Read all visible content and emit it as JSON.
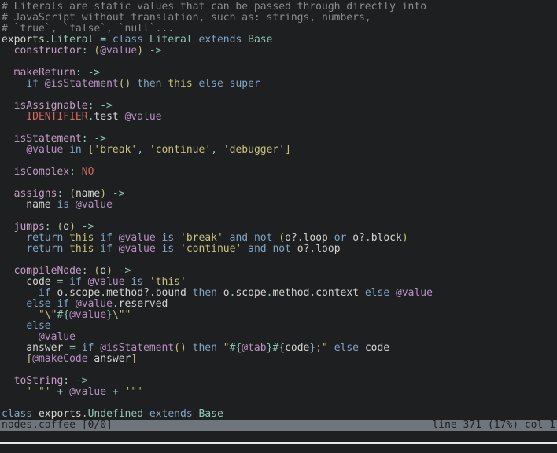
{
  "editor": {
    "filename": "nodes.coffee",
    "colors": {
      "background": "#1e1f21",
      "comment": "#8a8d91",
      "plain": "#d3d3d0",
      "class_name": "#8fc6b8",
      "keyword": "#7fa6c6",
      "property": "#c49dc5",
      "instance_var": "#b791c0",
      "string": "#c8c07a",
      "constant": "#d06a62",
      "statusbar_bg": "#6f767b"
    },
    "lines": [
      [
        [
          "comment",
          "# Literals are static values that can be passed through directly into"
        ]
      ],
      [
        [
          "comment",
          "# JavaScript without translation, such as: strings, numbers,"
        ]
      ],
      [
        [
          "comment",
          "# `true`, `false`, `null`..."
        ]
      ],
      [
        [
          "plain",
          "exports"
        ],
        [
          "op",
          "."
        ],
        [
          "class",
          "Literal"
        ],
        [
          "plain",
          " "
        ],
        [
          "op",
          "="
        ],
        [
          "plain",
          " "
        ],
        [
          "kw",
          "class"
        ],
        [
          "plain",
          " "
        ],
        [
          "class",
          "Literal"
        ],
        [
          "plain",
          " "
        ],
        [
          "kw",
          "extends"
        ],
        [
          "plain",
          " "
        ],
        [
          "class",
          "Base"
        ]
      ],
      [
        [
          "plain",
          "  "
        ],
        [
          "prop",
          "constructor"
        ],
        [
          "op",
          ":"
        ],
        [
          "plain",
          " "
        ],
        [
          "paren",
          "("
        ],
        [
          "ivar",
          "@value"
        ],
        [
          "paren",
          ")"
        ],
        [
          "plain",
          " "
        ],
        [
          "op",
          "->"
        ]
      ],
      [],
      [
        [
          "plain",
          "  "
        ],
        [
          "prop",
          "makeReturn"
        ],
        [
          "op",
          ":"
        ],
        [
          "plain",
          " "
        ],
        [
          "op",
          "->"
        ]
      ],
      [
        [
          "plain",
          "    "
        ],
        [
          "kw",
          "if"
        ],
        [
          "plain",
          " "
        ],
        [
          "ivar",
          "@isStatement"
        ],
        [
          "paren",
          "()"
        ],
        [
          "plain",
          " "
        ],
        [
          "kw",
          "then"
        ],
        [
          "plain",
          " "
        ],
        [
          "this",
          "this"
        ],
        [
          "plain",
          " "
        ],
        [
          "kw",
          "else"
        ],
        [
          "plain",
          " "
        ],
        [
          "kw",
          "super"
        ]
      ],
      [],
      [
        [
          "plain",
          "  "
        ],
        [
          "prop",
          "isAssignable"
        ],
        [
          "op",
          ":"
        ],
        [
          "plain",
          " "
        ],
        [
          "op",
          "->"
        ]
      ],
      [
        [
          "plain",
          "    "
        ],
        [
          "const",
          "IDENTIFIER"
        ],
        [
          "op",
          "."
        ],
        [
          "plain",
          "test "
        ],
        [
          "ivar",
          "@value"
        ]
      ],
      [],
      [
        [
          "plain",
          "  "
        ],
        [
          "prop",
          "isStatement"
        ],
        [
          "op",
          ":"
        ],
        [
          "plain",
          " "
        ],
        [
          "op",
          "->"
        ]
      ],
      [
        [
          "plain",
          "    "
        ],
        [
          "ivar",
          "@value"
        ],
        [
          "plain",
          " "
        ],
        [
          "kw",
          "in"
        ],
        [
          "plain",
          " "
        ],
        [
          "paren",
          "["
        ],
        [
          "str",
          "'break'"
        ],
        [
          "op",
          ","
        ],
        [
          "plain",
          " "
        ],
        [
          "str",
          "'continue'"
        ],
        [
          "op",
          ","
        ],
        [
          "plain",
          " "
        ],
        [
          "str",
          "'debugger'"
        ],
        [
          "paren",
          "]"
        ]
      ],
      [],
      [
        [
          "plain",
          "  "
        ],
        [
          "prop",
          "isComplex"
        ],
        [
          "op",
          ":"
        ],
        [
          "plain",
          " "
        ],
        [
          "const",
          "NO"
        ]
      ],
      [],
      [
        [
          "plain",
          "  "
        ],
        [
          "prop",
          "assigns"
        ],
        [
          "op",
          ":"
        ],
        [
          "plain",
          " "
        ],
        [
          "paren",
          "("
        ],
        [
          "plain",
          "name"
        ],
        [
          "paren",
          ")"
        ],
        [
          "plain",
          " "
        ],
        [
          "op",
          "->"
        ]
      ],
      [
        [
          "plain",
          "    name "
        ],
        [
          "kw",
          "is"
        ],
        [
          "plain",
          " "
        ],
        [
          "ivar",
          "@value"
        ]
      ],
      [],
      [
        [
          "plain",
          "  "
        ],
        [
          "prop",
          "jumps"
        ],
        [
          "op",
          ":"
        ],
        [
          "plain",
          " "
        ],
        [
          "paren",
          "("
        ],
        [
          "plain",
          "o"
        ],
        [
          "paren",
          ")"
        ],
        [
          "plain",
          " "
        ],
        [
          "op",
          "->"
        ]
      ],
      [
        [
          "plain",
          "    "
        ],
        [
          "kw",
          "return"
        ],
        [
          "plain",
          " "
        ],
        [
          "this",
          "this"
        ],
        [
          "plain",
          " "
        ],
        [
          "kw",
          "if"
        ],
        [
          "plain",
          " "
        ],
        [
          "ivar",
          "@value"
        ],
        [
          "plain",
          " "
        ],
        [
          "kw",
          "is"
        ],
        [
          "plain",
          " "
        ],
        [
          "str",
          "'break'"
        ],
        [
          "plain",
          " "
        ],
        [
          "kw",
          "and"
        ],
        [
          "plain",
          " "
        ],
        [
          "kw",
          "not"
        ],
        [
          "plain",
          " "
        ],
        [
          "paren",
          "("
        ],
        [
          "plain",
          "o?"
        ],
        [
          "op",
          "."
        ],
        [
          "plain",
          "loop "
        ],
        [
          "kw",
          "or"
        ],
        [
          "plain",
          " o?"
        ],
        [
          "op",
          "."
        ],
        [
          "plain",
          "block"
        ],
        [
          "paren",
          ")"
        ]
      ],
      [
        [
          "plain",
          "    "
        ],
        [
          "kw",
          "return"
        ],
        [
          "plain",
          " "
        ],
        [
          "this",
          "this"
        ],
        [
          "plain",
          " "
        ],
        [
          "kw",
          "if"
        ],
        [
          "plain",
          " "
        ],
        [
          "ivar",
          "@value"
        ],
        [
          "plain",
          " "
        ],
        [
          "kw",
          "is"
        ],
        [
          "plain",
          " "
        ],
        [
          "str",
          "'continue'"
        ],
        [
          "plain",
          " "
        ],
        [
          "kw",
          "and"
        ],
        [
          "plain",
          " "
        ],
        [
          "kw",
          "not"
        ],
        [
          "plain",
          " o?"
        ],
        [
          "op",
          "."
        ],
        [
          "plain",
          "loop"
        ]
      ],
      [],
      [
        [
          "plain",
          "  "
        ],
        [
          "prop",
          "compileNode"
        ],
        [
          "op",
          ":"
        ],
        [
          "plain",
          " "
        ],
        [
          "paren",
          "("
        ],
        [
          "plain",
          "o"
        ],
        [
          "paren",
          ")"
        ],
        [
          "plain",
          " "
        ],
        [
          "op",
          "->"
        ]
      ],
      [
        [
          "plain",
          "    code "
        ],
        [
          "op",
          "="
        ],
        [
          "plain",
          " "
        ],
        [
          "kw",
          "if"
        ],
        [
          "plain",
          " "
        ],
        [
          "ivar",
          "@value"
        ],
        [
          "plain",
          " "
        ],
        [
          "kw",
          "is"
        ],
        [
          "plain",
          " "
        ],
        [
          "str",
          "'this'"
        ]
      ],
      [
        [
          "plain",
          "      "
        ],
        [
          "kw",
          "if"
        ],
        [
          "plain",
          " o"
        ],
        [
          "op",
          "."
        ],
        [
          "plain",
          "scope"
        ],
        [
          "op",
          "."
        ],
        [
          "plain",
          "method?"
        ],
        [
          "op",
          "."
        ],
        [
          "plain",
          "bound "
        ],
        [
          "kw",
          "then"
        ],
        [
          "plain",
          " o"
        ],
        [
          "op",
          "."
        ],
        [
          "plain",
          "scope"
        ],
        [
          "op",
          "."
        ],
        [
          "plain",
          "method"
        ],
        [
          "op",
          "."
        ],
        [
          "plain",
          "context "
        ],
        [
          "kw",
          "else"
        ],
        [
          "plain",
          " "
        ],
        [
          "ivar",
          "@value"
        ]
      ],
      [
        [
          "plain",
          "    "
        ],
        [
          "kw",
          "else"
        ],
        [
          "plain",
          " "
        ],
        [
          "kw",
          "if"
        ],
        [
          "plain",
          " "
        ],
        [
          "ivar",
          "@value"
        ],
        [
          "op",
          "."
        ],
        [
          "plain",
          "reserved"
        ]
      ],
      [
        [
          "plain",
          "      "
        ],
        [
          "str",
          "\"\\\""
        ],
        [
          "interp",
          "#{"
        ],
        [
          "ivar",
          "@value"
        ],
        [
          "interp",
          "}"
        ],
        [
          "str",
          "\\\"\""
        ]
      ],
      [
        [
          "plain",
          "    "
        ],
        [
          "kw",
          "else"
        ]
      ],
      [
        [
          "plain",
          "      "
        ],
        [
          "ivar",
          "@value"
        ]
      ],
      [
        [
          "plain",
          "    answer "
        ],
        [
          "op",
          "="
        ],
        [
          "plain",
          " "
        ],
        [
          "kw",
          "if"
        ],
        [
          "plain",
          " "
        ],
        [
          "ivar",
          "@isStatement"
        ],
        [
          "paren",
          "()"
        ],
        [
          "plain",
          " "
        ],
        [
          "kw",
          "then"
        ],
        [
          "plain",
          " "
        ],
        [
          "str",
          "\""
        ],
        [
          "interp",
          "#{"
        ],
        [
          "ivar",
          "@tab"
        ],
        [
          "interp",
          "}#{"
        ],
        [
          "plain",
          "code"
        ],
        [
          "interp",
          "}"
        ],
        [
          "str",
          ";\""
        ],
        [
          "plain",
          " "
        ],
        [
          "kw",
          "else"
        ],
        [
          "plain",
          " code"
        ]
      ],
      [
        [
          "plain",
          "    "
        ],
        [
          "paren",
          "["
        ],
        [
          "ivar",
          "@makeCode"
        ],
        [
          "plain",
          " answer"
        ],
        [
          "paren",
          "]"
        ]
      ],
      [],
      [
        [
          "plain",
          "  "
        ],
        [
          "prop",
          "toString"
        ],
        [
          "op",
          ":"
        ],
        [
          "plain",
          " "
        ],
        [
          "op",
          "->"
        ]
      ],
      [
        [
          "plain",
          "    "
        ],
        [
          "str",
          "' \"'"
        ],
        [
          "plain",
          " "
        ],
        [
          "op",
          "+"
        ],
        [
          "plain",
          " "
        ],
        [
          "ivar",
          "@value"
        ],
        [
          "plain",
          " "
        ],
        [
          "op",
          "+"
        ],
        [
          "plain",
          " "
        ],
        [
          "str",
          "'\"'"
        ]
      ],
      [],
      [
        [
          "kw",
          "class"
        ],
        [
          "plain",
          " exports"
        ],
        [
          "op",
          "."
        ],
        [
          "class",
          "Undefined"
        ],
        [
          "plain",
          " "
        ],
        [
          "kw",
          "extends"
        ],
        [
          "plain",
          " "
        ],
        [
          "class",
          "Base"
        ]
      ]
    ]
  },
  "statusbar": {
    "left": "nodes.coffee [0/0]",
    "right": "line 371 (17%) col 1",
    "line": 371,
    "percent": 17,
    "col": 1
  }
}
